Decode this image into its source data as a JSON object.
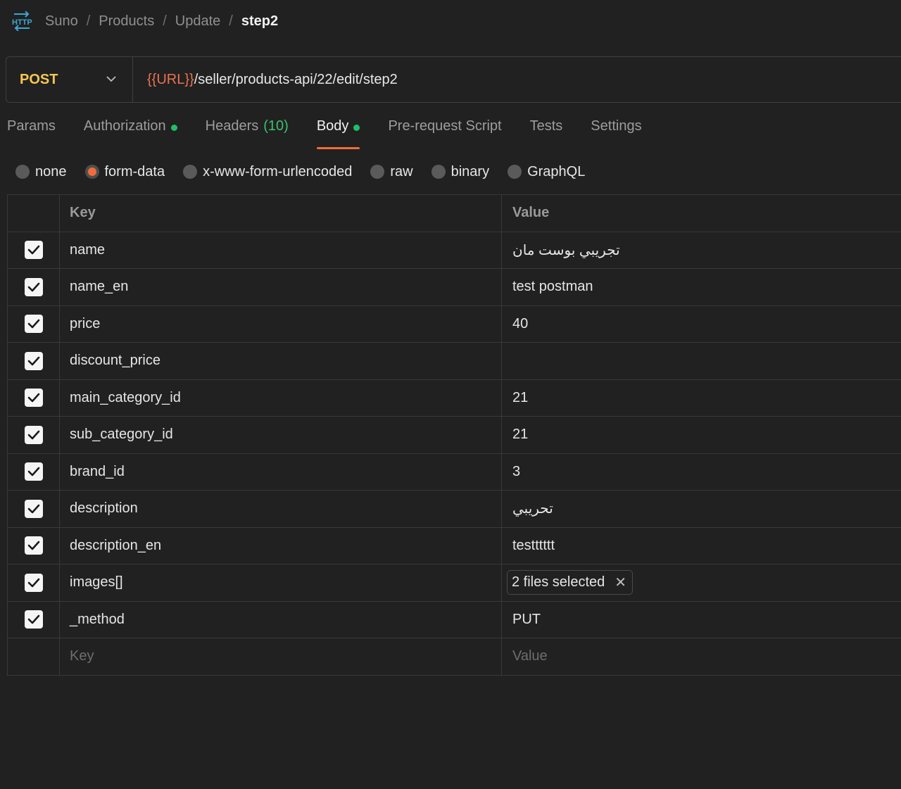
{
  "breadcrumb": {
    "items": [
      "Suno",
      "Products",
      "Update"
    ],
    "separator": "/",
    "current": "step2",
    "icon": "http-icon"
  },
  "request": {
    "method": "POST",
    "url_variable": "{{URL}}",
    "url_path": "/seller/products-api/22/edit/step2"
  },
  "tabs": [
    {
      "label": "Params"
    },
    {
      "label": "Authorization"
    },
    {
      "label": "Headers",
      "count": "(10)"
    },
    {
      "label": "Body"
    },
    {
      "label": "Pre-request Script"
    },
    {
      "label": "Tests"
    },
    {
      "label": "Settings"
    }
  ],
  "body_types": [
    "none",
    "form-data",
    "x-www-form-urlencoded",
    "raw",
    "binary",
    "GraphQL"
  ],
  "table": {
    "header_key": "Key",
    "header_value": "Value",
    "rows": [
      {
        "key": "name",
        "value": "تجريبي بوست مان"
      },
      {
        "key": "name_en",
        "value": "test postman"
      },
      {
        "key": "price",
        "value": "40"
      },
      {
        "key": "discount_price",
        "value": ""
      },
      {
        "key": "main_category_id",
        "value": "21"
      },
      {
        "key": "sub_category_id",
        "value": "21"
      },
      {
        "key": "brand_id",
        "value": "3"
      },
      {
        "key": "description",
        "value": "تحريبي"
      },
      {
        "key": "description_en",
        "value": "testttttt"
      },
      {
        "key": "images[]",
        "value": "2 files selected"
      },
      {
        "key": "_method",
        "value": "PUT"
      }
    ],
    "placeholder_key": "Key",
    "placeholder_value": "Value"
  },
  "colors": {
    "background": "#212121",
    "method": "#f8c652",
    "url_variable": "#ea7250",
    "active_tab_underline": "#f26b3a",
    "status_dot": "#1fbf66"
  }
}
